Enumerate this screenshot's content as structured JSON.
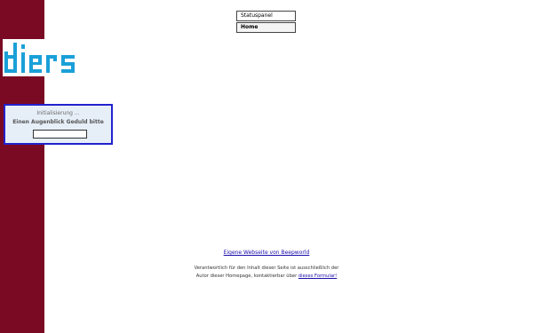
{
  "brand": {
    "logo_text": "diers",
    "logo_color": "#1aa0d8",
    "sidebar_color": "#7a0a24"
  },
  "loader": {
    "title": "Initialisierung ...",
    "message": "Einen Augenblick Geduld bitte",
    "progress": 0
  },
  "nav": {
    "items": [
      {
        "label": "Statuspanel"
      },
      {
        "label": "Home"
      }
    ]
  },
  "footer": {
    "link_text": "Eigene Webseite von Beepworld",
    "note_line1": "Verantwortlich für den Inhalt dieser Seite ist ausschließlich der",
    "note_line2_prefix": "Autor dieser Homepage, kontaktierbar über",
    "contact_link": "dieses Formular!"
  }
}
